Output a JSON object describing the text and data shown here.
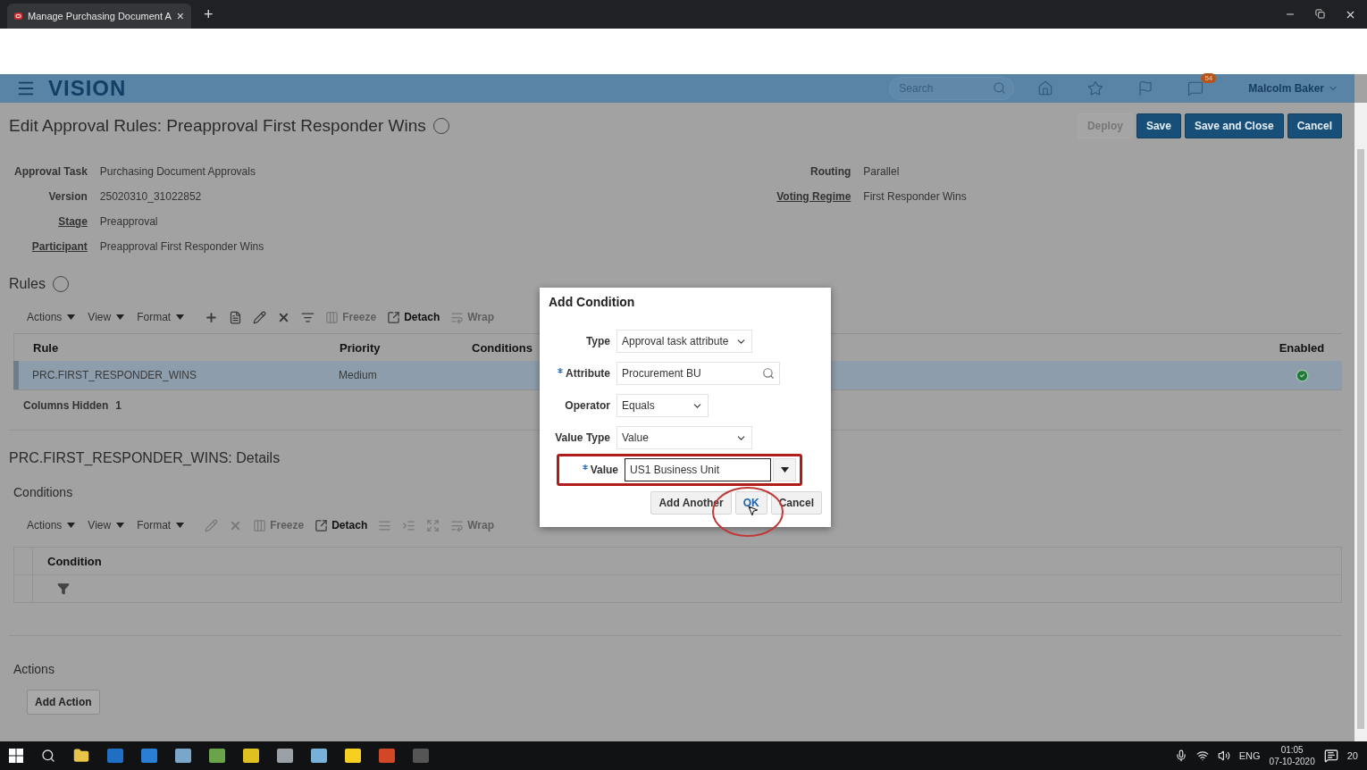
{
  "browser": {
    "tab_title": "Manage Purchasing Document A",
    "tab_close": "×",
    "new_tab": "+"
  },
  "header": {
    "brand": "VISION",
    "search": {
      "placeholder": "Search"
    },
    "notification_count": "54",
    "user": "Malcolm Baker"
  },
  "page": {
    "title": "Edit Approval Rules: Preapproval First Responder Wins",
    "buttons": [
      {
        "label": "Deploy",
        "disabled": true
      },
      {
        "label": "Save",
        "disabled": false
      },
      {
        "label": "Save and Close",
        "disabled": false
      },
      {
        "label": "Cancel",
        "disabled": false
      }
    ]
  },
  "info_left": [
    {
      "label": "Approval Task",
      "value": "Purchasing Document Approvals",
      "link": false
    },
    {
      "label": "Version",
      "value": "25020310_31022852",
      "link": false
    },
    {
      "label": "Stage",
      "value": "Preapproval",
      "link": true
    },
    {
      "label": "Participant",
      "value": "Preapproval First Responder Wins",
      "link": true
    }
  ],
  "info_right": [
    {
      "label": "Routing",
      "value": "Parallel",
      "link": false
    },
    {
      "label": "Voting Regime",
      "value": "First Responder Wins",
      "link": true
    }
  ],
  "rules": {
    "title": "Rules",
    "menus": [
      "Actions",
      "View",
      "Format"
    ],
    "tools": [
      {
        "kind": "add",
        "disabled": false
      },
      {
        "kind": "list",
        "disabled": false
      },
      {
        "kind": "edit",
        "disabled": false
      },
      {
        "kind": "delete",
        "disabled": false
      },
      {
        "kind": "qbe",
        "disabled": false
      },
      {
        "kind": "freeze",
        "label": "Freeze",
        "disabled": true
      },
      {
        "kind": "detach",
        "label": "Detach",
        "disabled": false
      },
      {
        "kind": "wrap",
        "label": "Wrap",
        "disabled": true
      }
    ],
    "columns": [
      "Rule",
      "Priority",
      "Conditions",
      "Enabled"
    ],
    "rows": [
      {
        "rule": "PRC.FIRST_RESPONDER_WINS",
        "priority": "Medium",
        "enabled": true,
        "selected": true
      }
    ],
    "hidden_label": "Columns Hidden",
    "hidden_count": "1"
  },
  "details": {
    "title": "PRC.FIRST_RESPONDER_WINS: Details",
    "conditions_title": "Conditions",
    "menus": [
      "Actions",
      "View",
      "Format"
    ],
    "tools": [
      {
        "kind": "edit",
        "disabled": true
      },
      {
        "kind": "delete",
        "disabled": true
      },
      {
        "kind": "freeze",
        "label": "Freeze",
        "disabled": true
      },
      {
        "kind": "detach",
        "label": "Detach",
        "disabled": false
      },
      {
        "kind": "rows",
        "disabled": true
      },
      {
        "kind": "indent",
        "disabled": true
      },
      {
        "kind": "expand",
        "disabled": true
      },
      {
        "kind": "wrap",
        "label": "Wrap",
        "disabled": true
      }
    ],
    "columns": [
      "Condition"
    ],
    "actions_title": "Actions",
    "add_action": "Add Action"
  },
  "dialog": {
    "title": "Add Condition",
    "fields": [
      {
        "kind": "select",
        "label": "Type",
        "value": "Approval task attribute",
        "required": false,
        "highlighted": false
      },
      {
        "kind": "search",
        "label": "Attribute",
        "value": "Procurement BU",
        "required": true,
        "highlighted": false
      },
      {
        "kind": "select",
        "label": "Operator",
        "value": "Equals",
        "required": false,
        "highlighted": false
      },
      {
        "kind": "select",
        "label": "Value Type",
        "value": "Value",
        "required": false,
        "highlighted": false
      },
      {
        "kind": "combo",
        "label": "Value",
        "value": "US1 Business Unit",
        "required": true,
        "highlighted": true
      }
    ],
    "buttons": [
      {
        "label": "Add Another",
        "focused": false
      },
      {
        "label": "OK",
        "focused": true
      },
      {
        "label": "Cancel",
        "focused": false
      }
    ]
  },
  "taskbar": {
    "language": "ENG",
    "time": "01:05",
    "date": "07-10-2020",
    "notifications": "20"
  }
}
